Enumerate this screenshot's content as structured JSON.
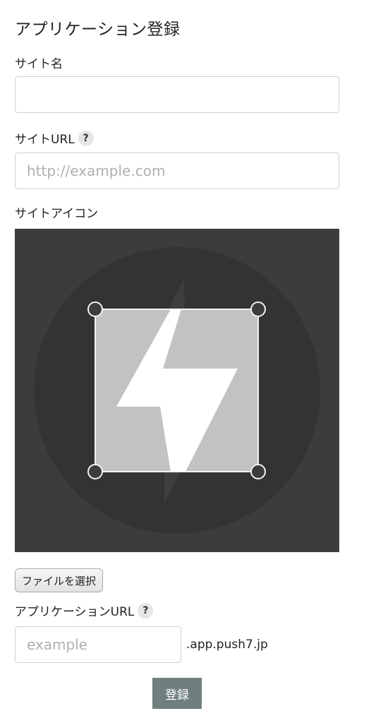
{
  "page": {
    "title": "アプリケーション登録"
  },
  "form": {
    "site_name": {
      "label": "サイト名",
      "value": "",
      "placeholder": ""
    },
    "site_url": {
      "label": "サイトURL",
      "help": "?",
      "value": "",
      "placeholder": "http://example.com"
    },
    "site_icon": {
      "label": "サイトアイコン",
      "file_button_label": "ファイルを選択"
    },
    "app_url": {
      "label": "アプリケーションURL",
      "help": "?",
      "value": "",
      "placeholder": "example",
      "suffix": ".app.push7.jp"
    },
    "submit_label": "登録"
  },
  "icons": {
    "help": "question-circle-icon",
    "default_site_icon": "lightning-bolt-icon",
    "crop_handle": "circle-handle-icon"
  },
  "colors": {
    "icon_background": "#3c3c3c",
    "icon_circle": "#333333",
    "submit_button": "#6f7f7e",
    "help_badge": "#e6e6e6"
  }
}
